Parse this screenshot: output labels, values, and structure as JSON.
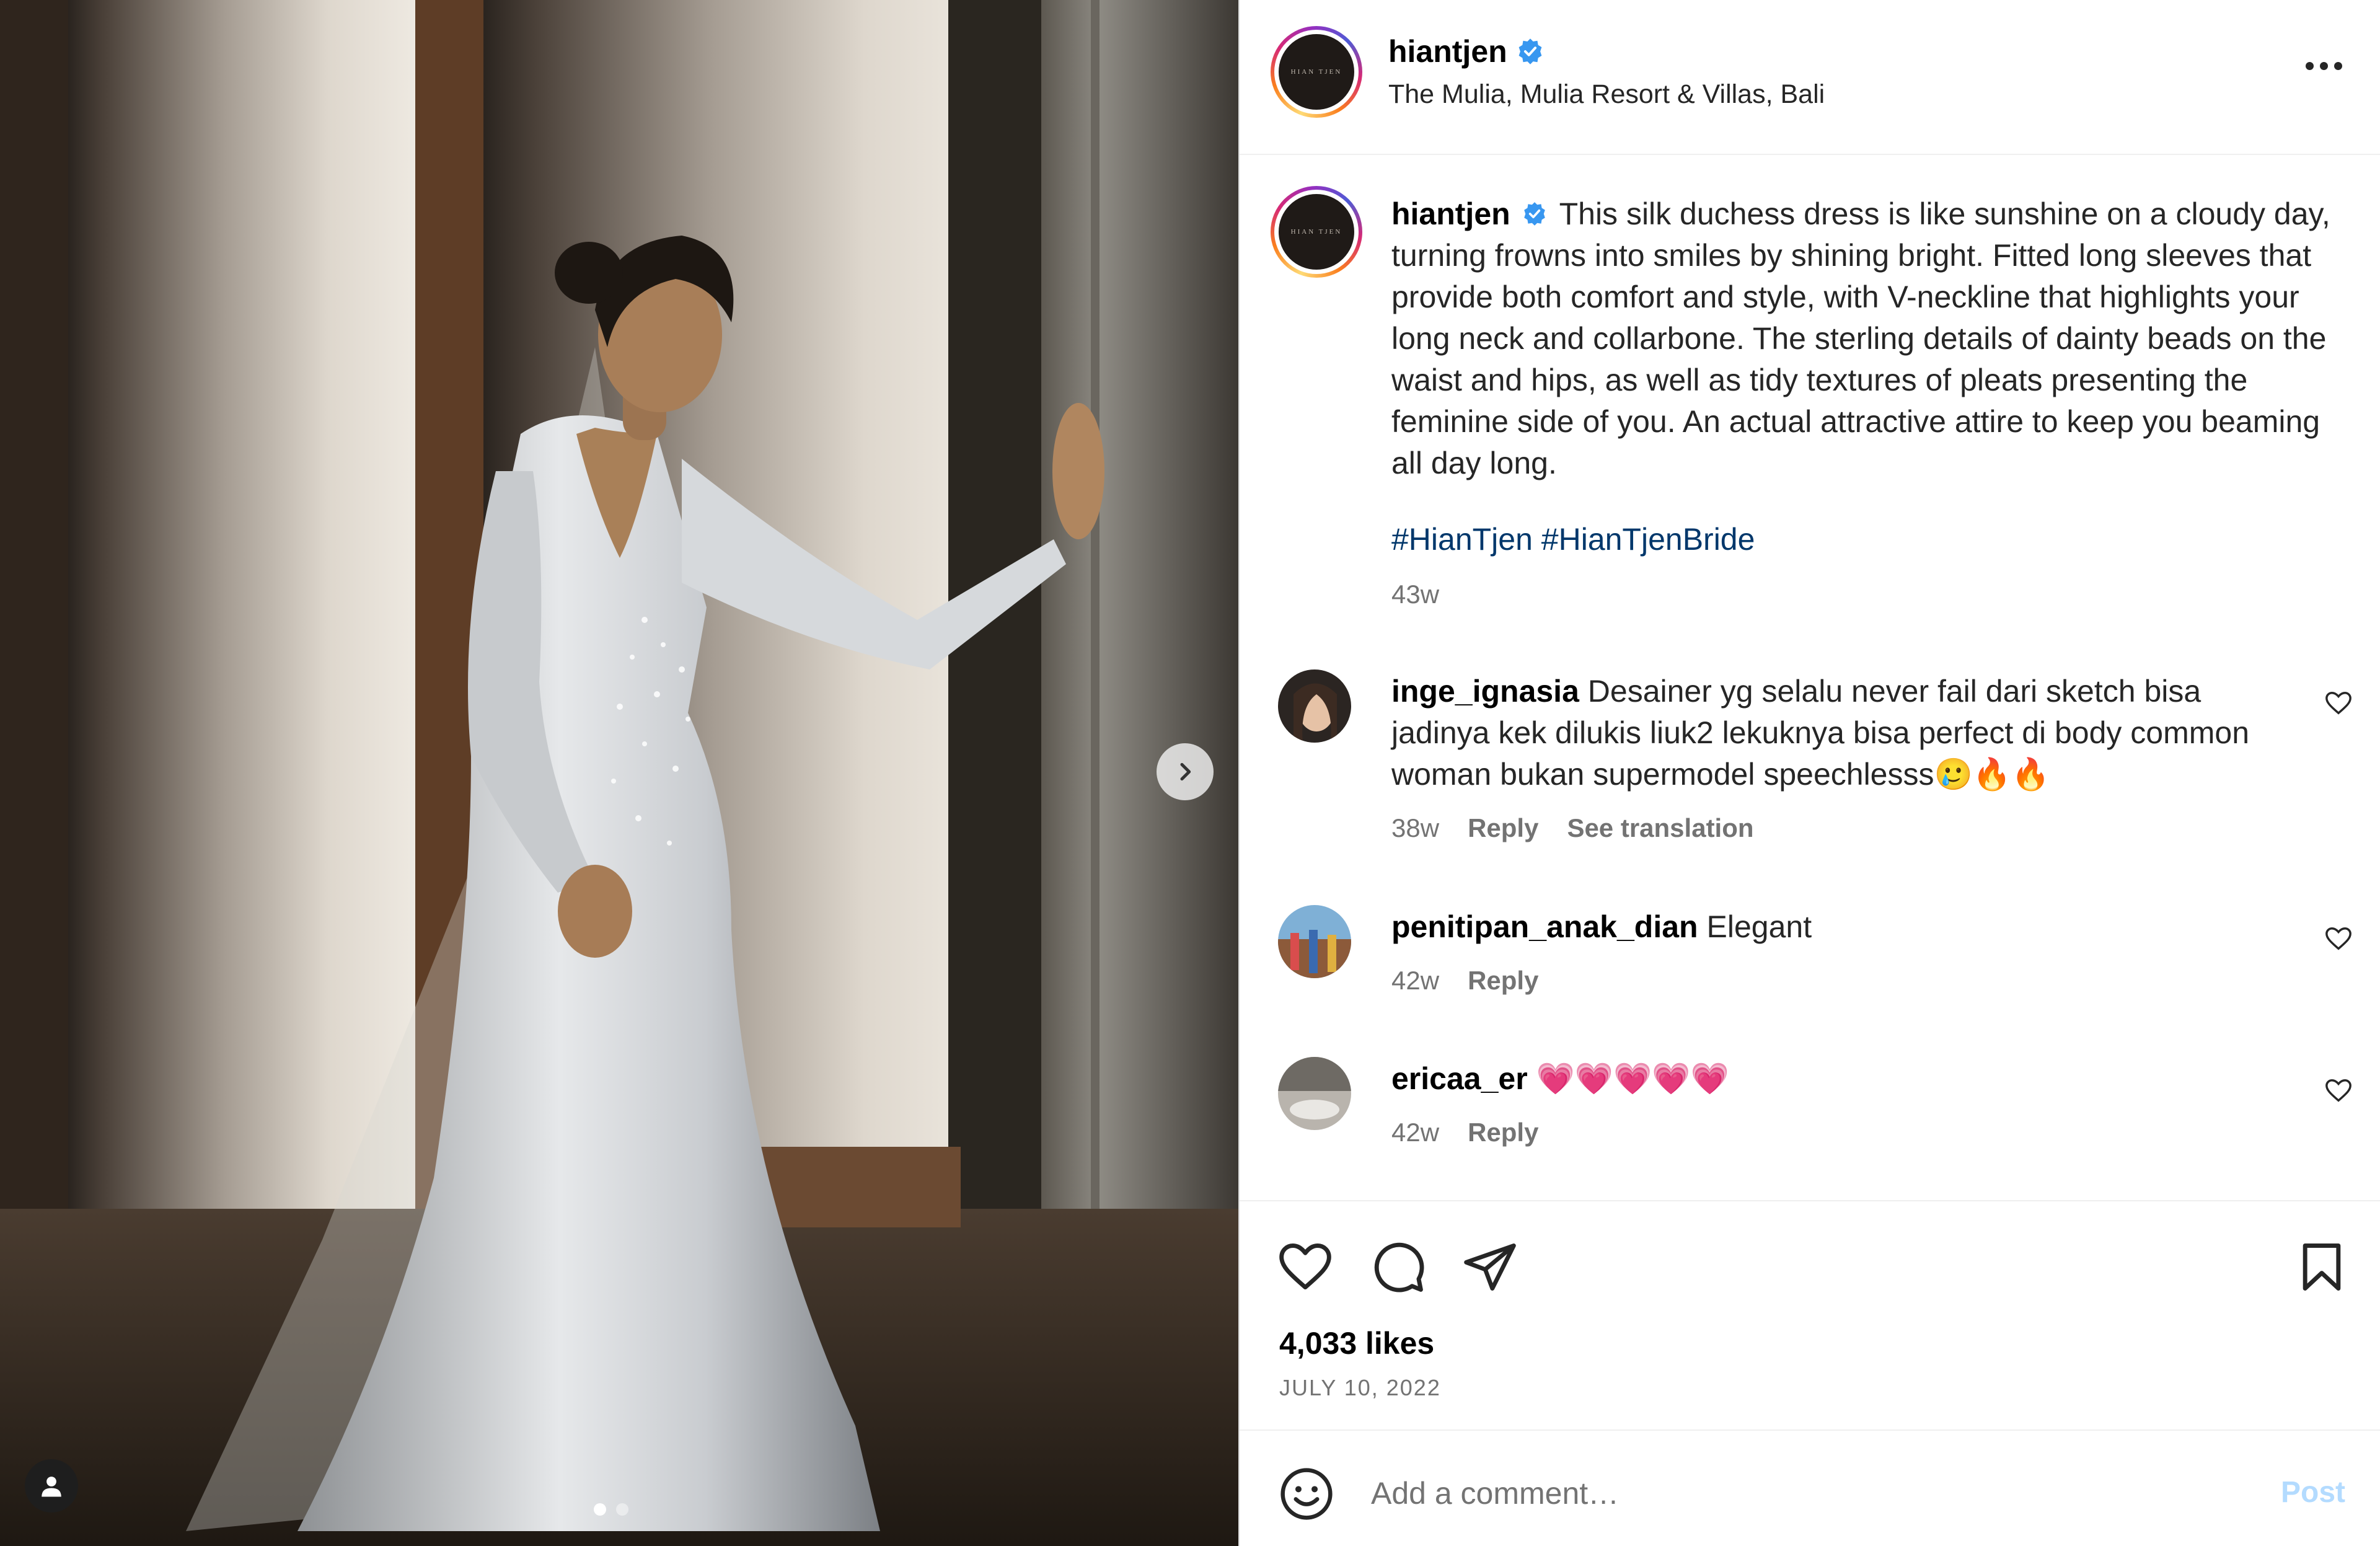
{
  "post": {
    "username": "hiantjen",
    "location": "The Mulia, Mulia Resort & Villas, Bali",
    "avatar_text": "HIAN TJEN",
    "caption": "This silk duchess dress is like sunshine on a cloudy day, turning frowns into smiles by shining bright. Fitted long sleeves that provide both comfort and style, with V-neckline that highlights your long neck and collarbone. The sterling details of dainty beads on the waist and hips, as well as tidy textures of pleats presenting the feminine side of you. An actual attractive attire to keep you beaming all day long.",
    "hashtags": "#HianTjen #HianTjenBride",
    "time": "43w",
    "likes": "4,033 likes",
    "date": "JULY 10, 2022"
  },
  "comments": [
    {
      "username": "inge_ignasia",
      "text": "Desainer yg selalu never fail dari sketch bisa jadinya kek dilukis liuk2 lekuknya bisa perfect di body common woman bukan supermodel speechlesss🥲🔥🔥",
      "time": "38w",
      "reply": "Reply",
      "translate": "See translation"
    },
    {
      "username": "penitipan_anak_dian",
      "text": "Elegant",
      "time": "42w",
      "reply": "Reply"
    },
    {
      "username": "ericaa_er",
      "text": "💗💗💗💗💗",
      "time": "42w",
      "reply": "Reply"
    }
  ],
  "composer": {
    "placeholder": "Add a comment…",
    "post_label": "Post"
  },
  "carousel": {
    "count": 2,
    "active": 1
  },
  "colors": {
    "link": "#00376b",
    "muted": "#737373",
    "verified": "#3897f0",
    "post_disabled": "#b3dbff"
  },
  "icons": [
    "verified-badge-icon",
    "more-options-icon",
    "like-icon",
    "comment-icon",
    "share-icon",
    "save-icon",
    "emoji-icon",
    "chevron-right-icon",
    "user-tag-icon",
    "heart-small-icon"
  ]
}
